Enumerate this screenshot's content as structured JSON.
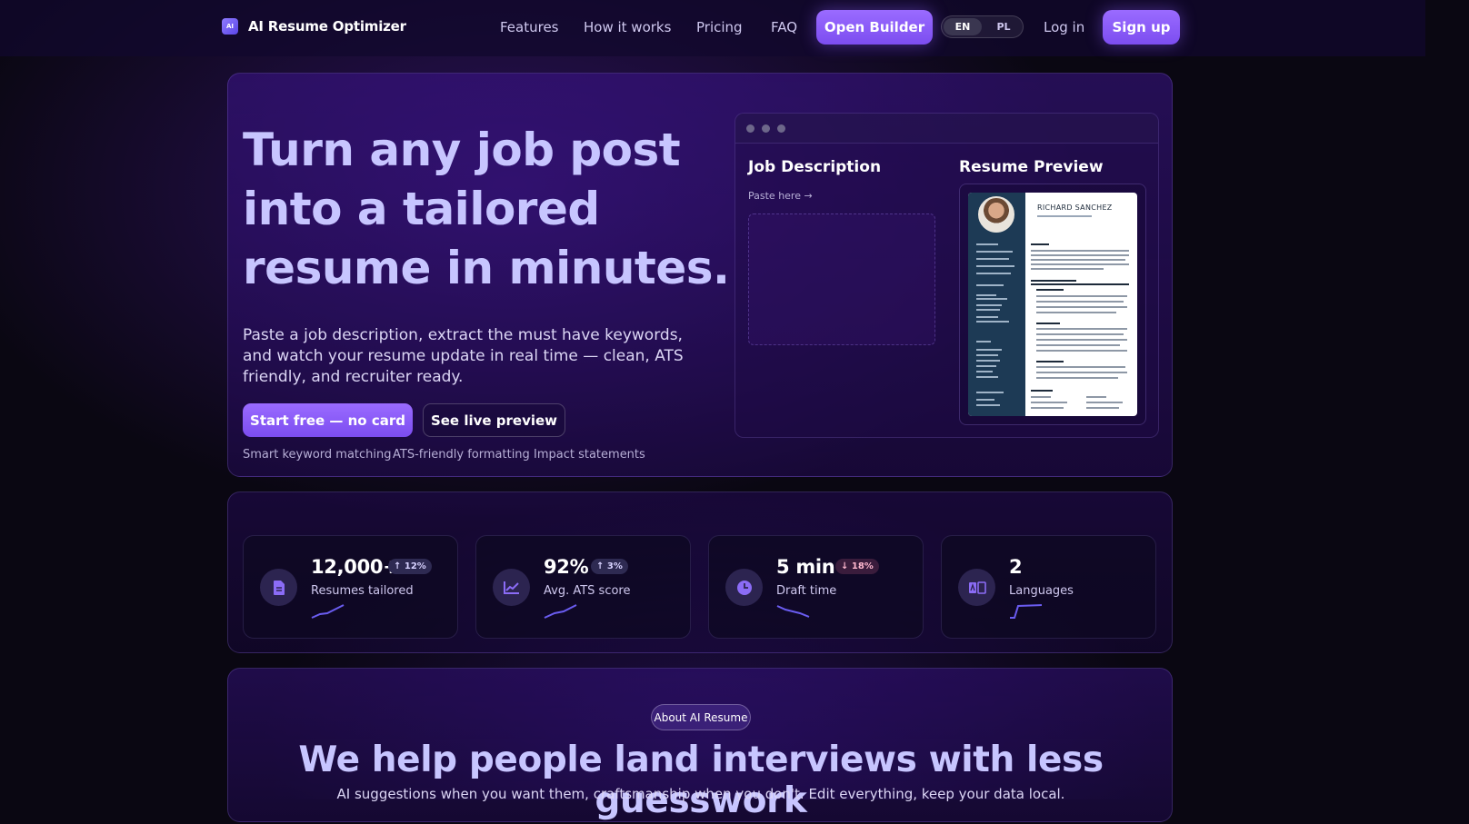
{
  "nav": {
    "brand_icon": "AI",
    "brand_name": "AI Resume Optimizer",
    "links": [
      "Features",
      "How it works",
      "Pricing",
      "FAQ"
    ],
    "open_builder": "Open Builder",
    "lang": {
      "en": "EN",
      "pl": "PL",
      "active": "EN"
    },
    "login": "Log in",
    "signup": "Sign up"
  },
  "hero": {
    "title": "Turn any job post into a tailored resume in minutes.",
    "subtitle": "Paste a job description, extract the must have keywords, and watch your resume update in real time — clean, ATS friendly, and recruiter ready.",
    "primary_cta": "Start free — no card",
    "secondary_cta": "See live preview",
    "feature_tags": [
      "Smart keyword matching",
      "ATS-friendly formatting",
      "Impact statements"
    ]
  },
  "preview": {
    "job_description_title": "Job Description",
    "paste_hint": "Paste here →",
    "resume_preview_title": "Resume Preview",
    "resume_name": "RICHARD SANCHEZ"
  },
  "stats": [
    {
      "icon": "document-icon",
      "value": "12,000+",
      "label": "Resumes tailored",
      "delta": "↑ 12%",
      "trend": "up"
    },
    {
      "icon": "chart-icon",
      "value": "92%",
      "label": "Avg. ATS score",
      "delta": "↑ 3%",
      "trend": "up"
    },
    {
      "icon": "clock-icon",
      "value": "5 min",
      "label": "Draft time",
      "delta": "↓ 18%",
      "trend": "down"
    },
    {
      "icon": "translate-icon",
      "value": "2",
      "label": "Languages",
      "delta": "",
      "trend": "up"
    }
  ],
  "about": {
    "pill": "About AI Resume",
    "title": "We help people land interviews with less guesswork",
    "subtitle": "AI suggestions when you want them, craftsmanship when you don't. Edit everything, keep your data local."
  },
  "colors": {
    "accent": "#8b5cf6",
    "title": "#c7c5ff",
    "background": "#0a0712",
    "delta_down": "#ffb8cf"
  }
}
